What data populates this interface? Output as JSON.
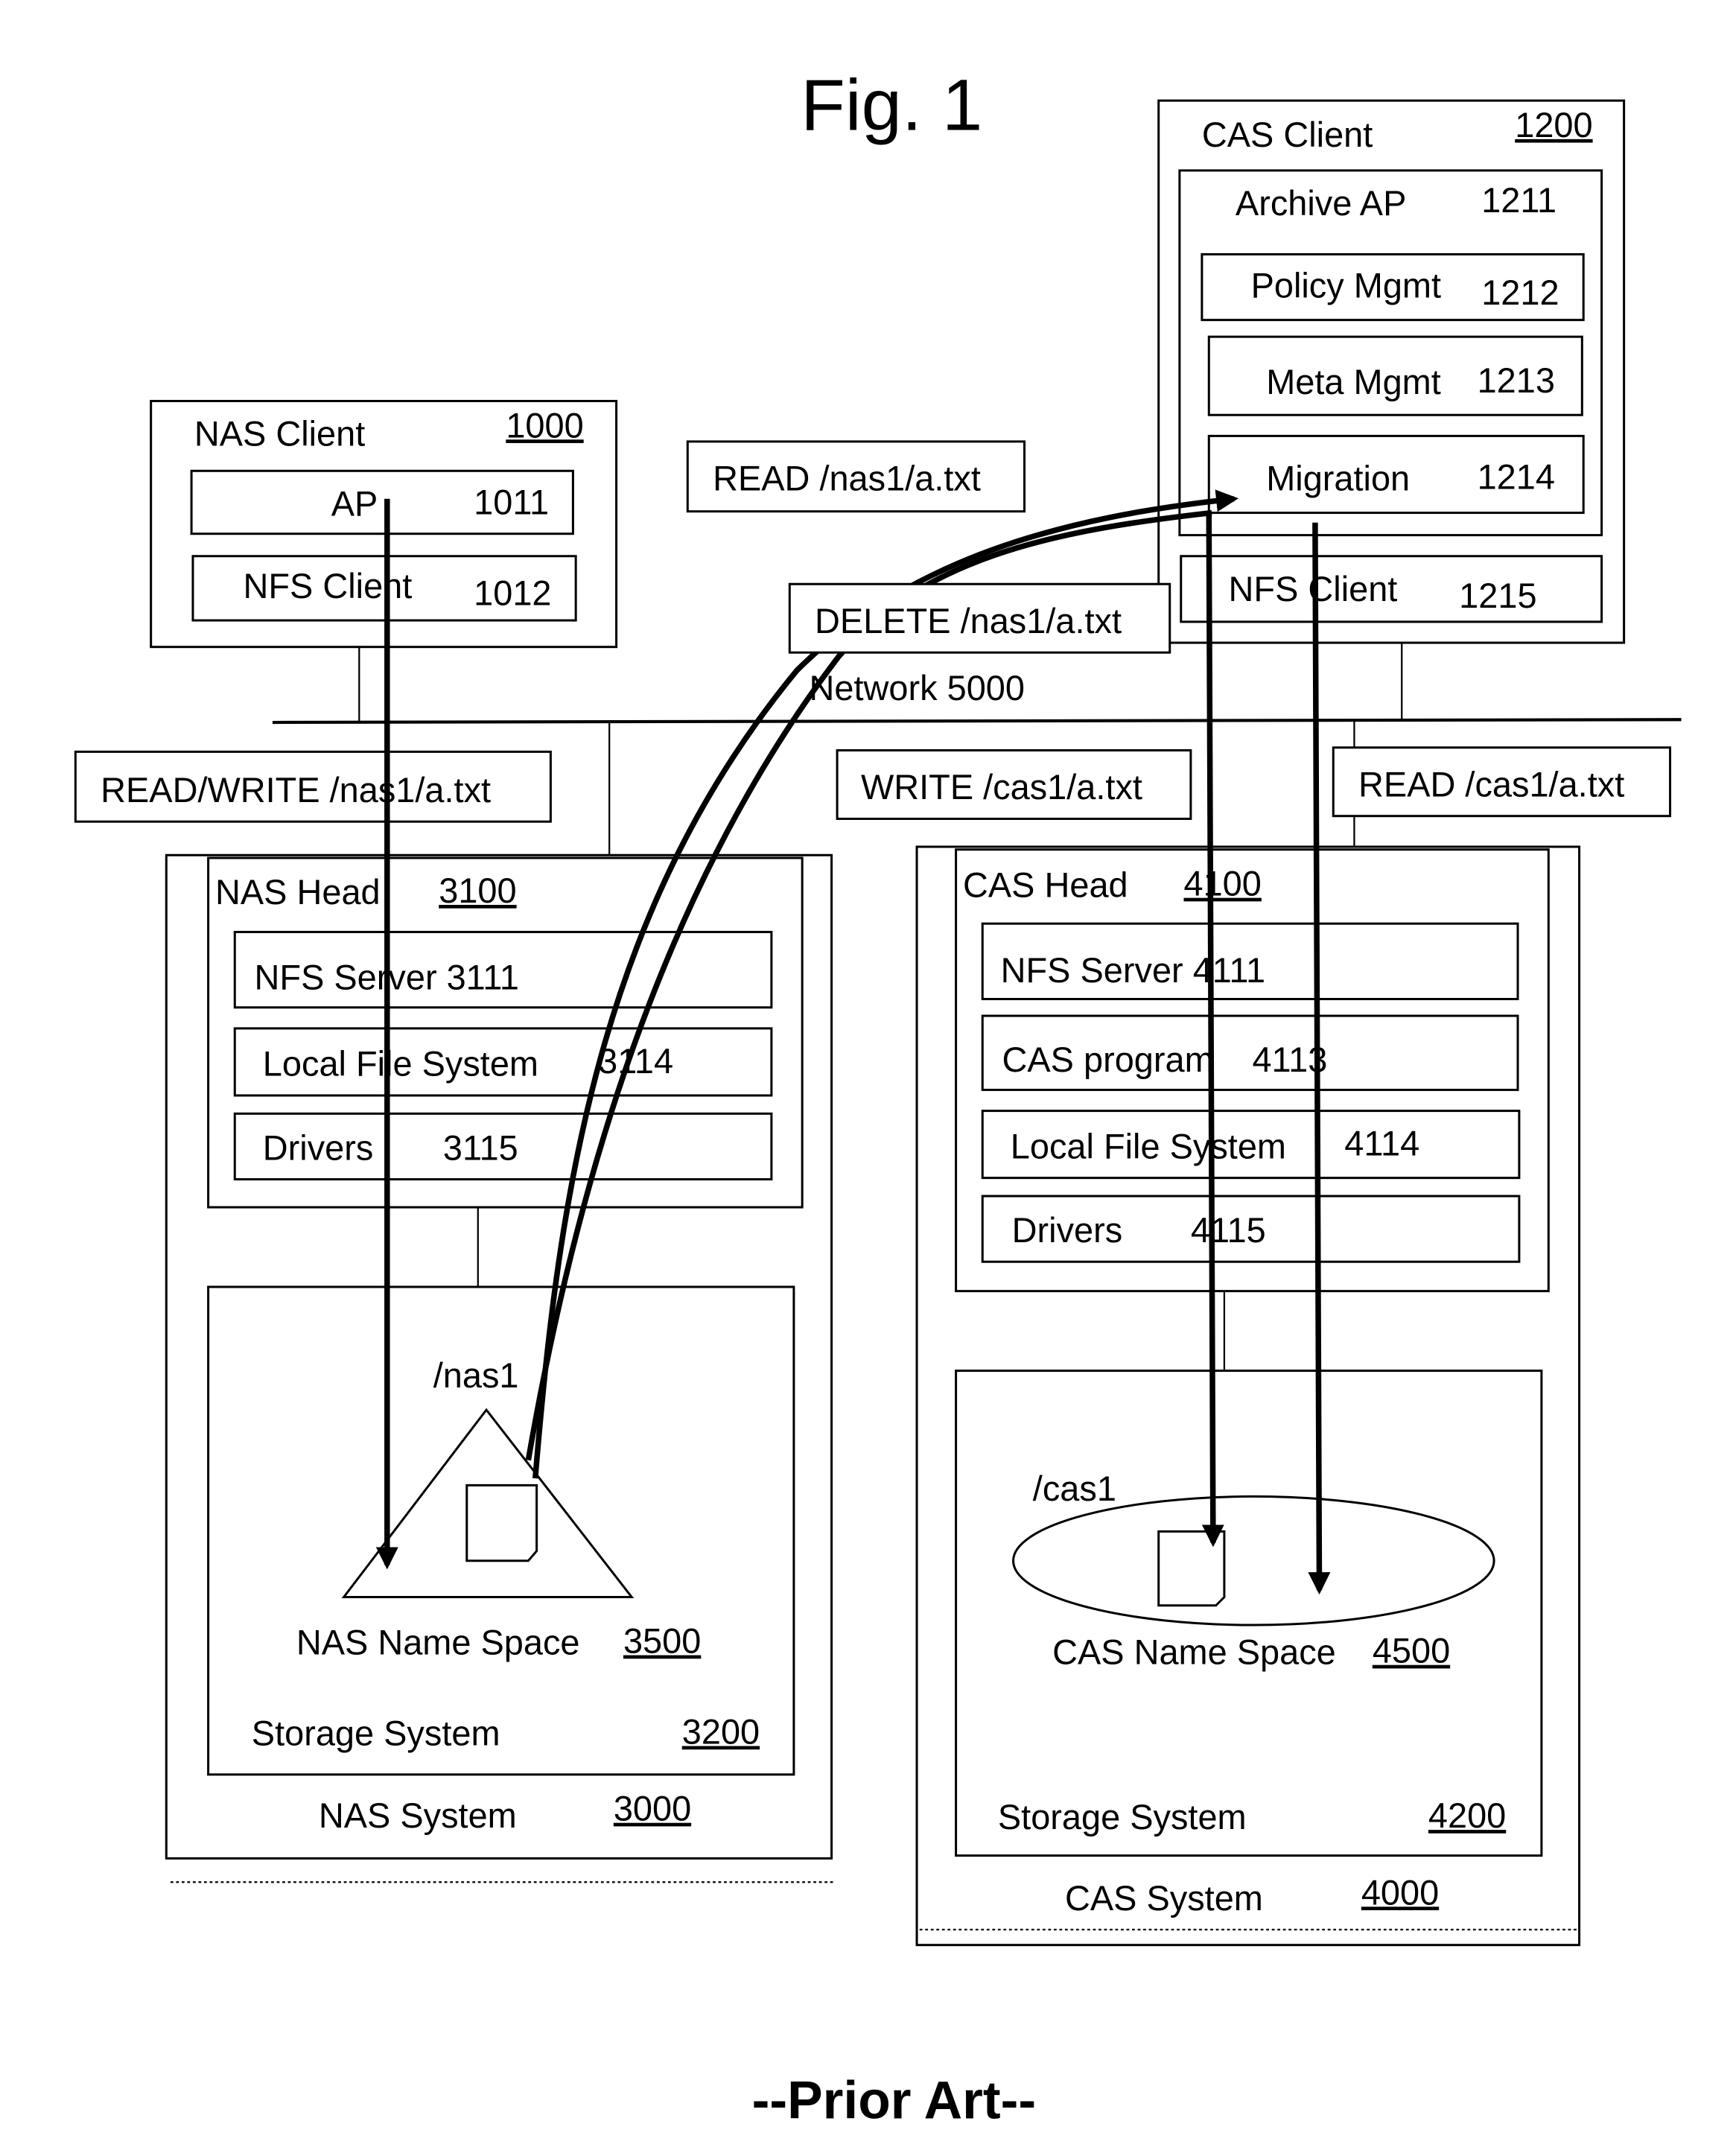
{
  "figure": {
    "title": "Fig. 1",
    "footer": "--Prior Art--"
  },
  "nas_client": {
    "label": "NAS Client",
    "ref": "1000",
    "ap": {
      "label": "AP",
      "ref": "1011"
    },
    "nfs_client": {
      "label": "NFS Client",
      "ref": "1012"
    }
  },
  "cas_client": {
    "label": "CAS Client",
    "ref": "1200",
    "archive_ap": {
      "label": "Archive AP",
      "ref": "1211"
    },
    "policy_mgmt": {
      "label": "Policy Mgmt",
      "ref": "1212"
    },
    "meta_mgmt": {
      "label": "Meta Mgmt",
      "ref": "1213"
    },
    "migration": {
      "label": "Migration",
      "ref": "1214"
    },
    "nfs_client": {
      "label": "NFS Client",
      "ref": "1215"
    }
  },
  "network": {
    "label": "Network 5000"
  },
  "operations": {
    "read_nas": "READ /nas1/a.txt",
    "delete_nas": "DELETE /nas1/a.txt",
    "read_write_nas": "READ/WRITE /nas1/a.txt",
    "write_cas": "WRITE /cas1/a.txt",
    "read_cas": "READ /cas1/a.txt"
  },
  "nas_system": {
    "label": "NAS System",
    "ref": "3000",
    "head": {
      "label": "NAS Head",
      "ref": "3100"
    },
    "nfs_server": {
      "label": "NFS Server 3111"
    },
    "local_fs": {
      "label": "Local File System",
      "ref": "3114"
    },
    "drivers": {
      "label": "Drivers",
      "ref": "3115"
    },
    "storage": {
      "label": "Storage System",
      "ref": "3200"
    },
    "namespace": {
      "label": "NAS Name Space",
      "ref": "3500",
      "mount": "/nas1"
    }
  },
  "cas_system": {
    "label": "CAS System",
    "ref": "4000",
    "head": {
      "label": "CAS Head",
      "ref": "4100"
    },
    "nfs_server": {
      "label": "NFS Server 4111"
    },
    "cas_program": {
      "label": "CAS program",
      "ref": "4113"
    },
    "local_fs": {
      "label": "Local File System",
      "ref": "4114"
    },
    "drivers": {
      "label": "Drivers",
      "ref": "4115"
    },
    "storage": {
      "label": "Storage System",
      "ref": "4200"
    },
    "namespace": {
      "label": "CAS Name Space",
      "ref": "4500",
      "mount": "/cas1"
    }
  }
}
